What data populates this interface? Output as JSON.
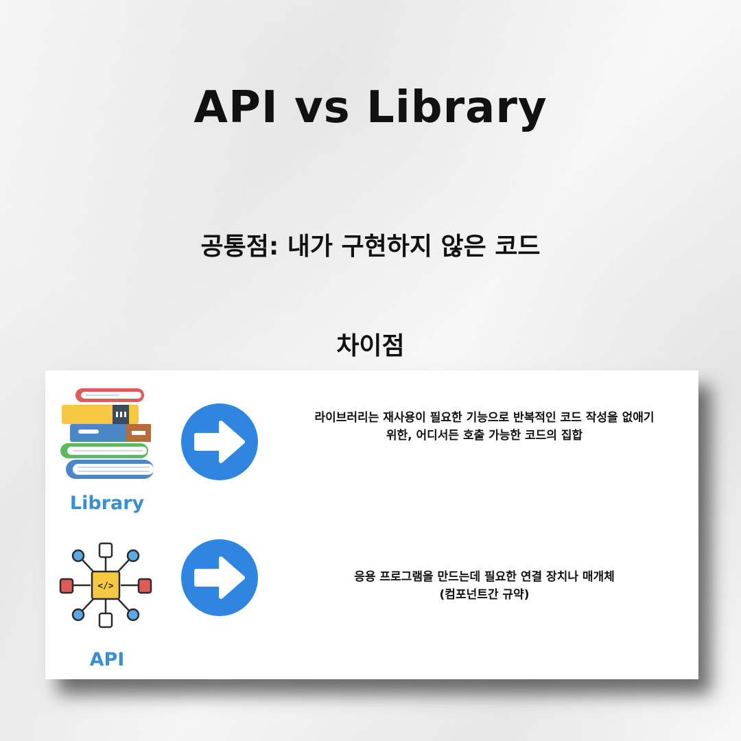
{
  "title": "API vs Library",
  "common": "공통점: 내가 구현하지 않은 코드",
  "differences_heading": "차이점",
  "items": [
    {
      "label": "Library",
      "icon": "books-icon",
      "arrow_icon": "arrow-right-circle-icon",
      "desc_line1": "라이브러리는 재사용이 필요한 기능으로 반복적인 코드 작성을 없애기",
      "desc_line2": "위한, 어디서든 호출 가능한 코드의 집합"
    },
    {
      "label": "API",
      "icon": "api-network-icon",
      "arrow_icon": "arrow-right-circle-icon",
      "desc_line1": "응용 프로그램을 만드는데 필요한 연결 장치나 매개체",
      "desc_line2": "(컴포넌트간 규약)"
    }
  ],
  "colors": {
    "accent_blue": "#3a8fd0",
    "arrow_blue": "#2f86e0",
    "text": "#111111"
  }
}
